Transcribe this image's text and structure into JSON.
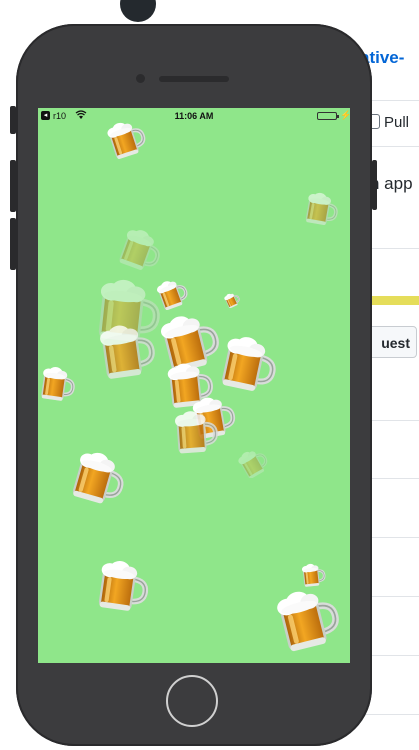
{
  "background_page": {
    "title_fragment": "ative-",
    "pulls_label": "Pull",
    "description_fragment": "n app",
    "button_label": "uest"
  },
  "phone": {
    "status_bar": {
      "back_label": "◂",
      "carrier": "r10",
      "time": "11:06 AM"
    },
    "screen_color": "#8fe68a"
  },
  "animation": {
    "emoji": "beer-mug",
    "mug_count": 18
  }
}
